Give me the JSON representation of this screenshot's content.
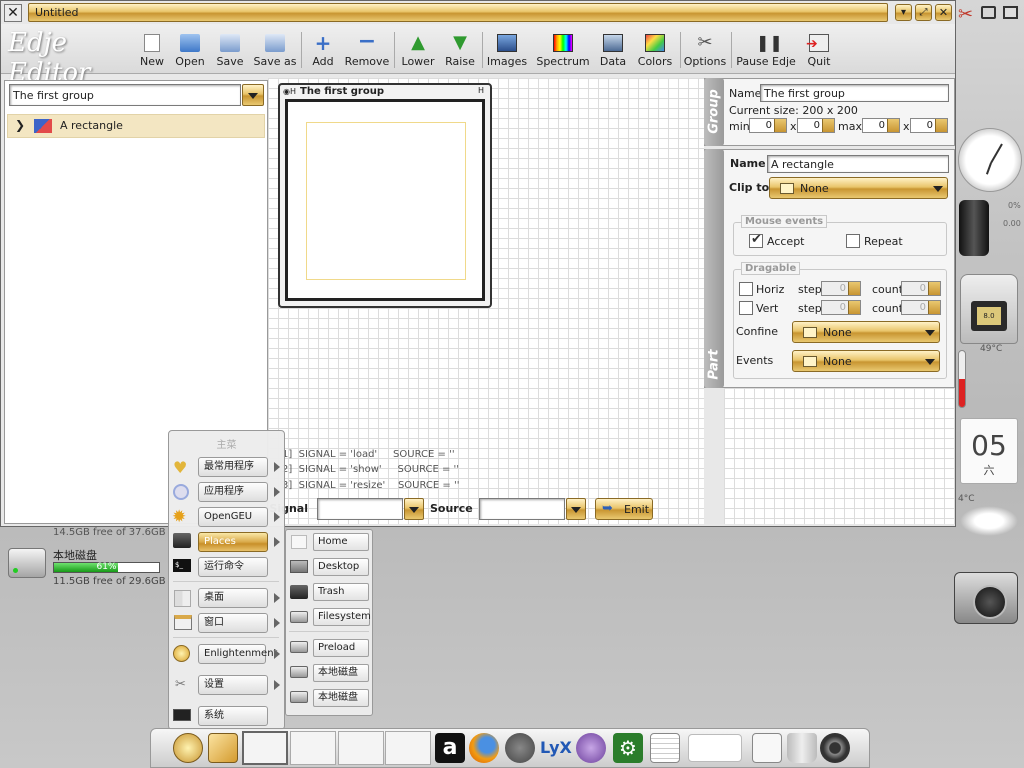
{
  "window": {
    "title": "Untitled"
  },
  "toolbar": {
    "new": "New",
    "open": "Open",
    "save": "Save",
    "save_as": "Save as",
    "add": "Add",
    "remove": "Remove",
    "lower": "Lower",
    "raise": "Raise",
    "images": "Images",
    "spectrum": "Spectrum",
    "data": "Data",
    "colors": "Colors",
    "options": "Options",
    "pause": "Pause Edje",
    "quit": "Quit"
  },
  "left": {
    "group_combo": "The first group",
    "tree_item": "A rectangle"
  },
  "canvas": {
    "group_window_title": "The first group"
  },
  "group_panel": {
    "tab_label": "Group",
    "name_label": "Name",
    "name_value": "The first group",
    "current_size": "Current size: 200 x 200",
    "min_label": "min",
    "max_label": "max",
    "x": "x",
    "min_w": "0",
    "min_h": "0",
    "max_w": "0",
    "max_h": "0"
  },
  "part_panel": {
    "tab_label": "Part",
    "name_label": "Name",
    "name_value": "A rectangle",
    "clip_label": "Clip to",
    "clip_value": "None",
    "mouse_events": "Mouse events",
    "accept": "Accept",
    "repeat": "Repeat",
    "dragable": "Dragable",
    "horiz": "Horiz",
    "vert": "Vert",
    "step": "step",
    "count": "count",
    "h_step": "0",
    "h_count": "0",
    "v_step": "0",
    "v_count": "0",
    "confine_label": "Confine",
    "confine_value": "None",
    "events_label": "Events",
    "events_value": "None"
  },
  "signals": {
    "lines": [
      "1]  SIGNAL = 'load'     SOURCE = ''",
      "2]  SIGNAL = 'show'     SOURCE = ''",
      "3]  SIGNAL = 'resize'    SOURCE = ''"
    ],
    "signal_label": "Signal",
    "source_label": "Source",
    "emit": "Emit"
  },
  "disks": {
    "top_free": "14.5GB free of 37.6GB",
    "name": "本地磁盘",
    "percent": "61%",
    "percent_value": 0.61,
    "free": "11.5GB free of 29.6GB"
  },
  "menu": {
    "title": "主菜",
    "items": [
      "最常用程序",
      "应用程序",
      "OpenGEU",
      "Places",
      "运行命令",
      "桌面",
      "窗口",
      "Enlightenment",
      "设置",
      "系统"
    ]
  },
  "places": {
    "items": [
      "Home",
      "Desktop",
      "Trash",
      "Filesystem",
      "Preload",
      "本地磁盘",
      "本地磁盘"
    ]
  },
  "gadgets": {
    "cpu_pct": "0%",
    "cpu_val": "0.00",
    "temp": "49°C",
    "date_day": "05",
    "date_week": "六",
    "weather_temp": "4°C"
  },
  "colors": {
    "accent_gold": "#d9a94a",
    "progress_green": "#2bb52b"
  }
}
